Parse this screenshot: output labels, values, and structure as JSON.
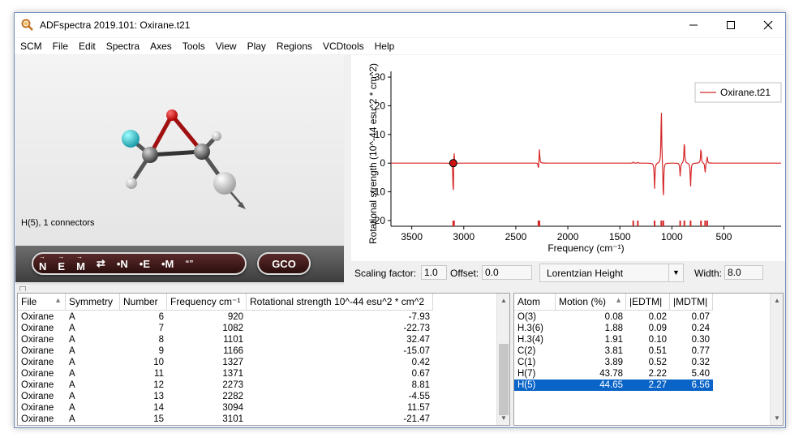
{
  "window": {
    "title": "ADFspectra 2019.101: Oxirane.t21",
    "controls": {
      "minimize_icon": "minimize-icon",
      "maximize_icon": "maximize-icon",
      "close_icon": "close-icon"
    }
  },
  "menu": [
    "SCM",
    "File",
    "Edit",
    "Spectra",
    "Axes",
    "Tools",
    "View",
    "Play",
    "Regions",
    "VCDtools",
    "Help"
  ],
  "molecule": {
    "status": "H(5), 1 connectors"
  },
  "view_toolbar": {
    "buttons": [
      "N",
      "E",
      "M",
      "⇄",
      "•N",
      "•E",
      "•M",
      "“”"
    ],
    "gco_label": "GCO"
  },
  "spectrum": {
    "legend": "Oxirane.t21",
    "ylabel": "Rotational strength (10^-44 esu^2 * cm^2)",
    "xlabel": "Frequency (cm⁻¹)",
    "y_ticks": [
      "30",
      "20",
      "10",
      "0",
      "-10",
      "-20"
    ],
    "x_ticks": [
      "3500",
      "3000",
      "2500",
      "2000",
      "1500",
      "1000",
      "500"
    ],
    "line_color": "#d62728"
  },
  "chart_data": {
    "type": "line",
    "title": "",
    "xlabel": "Frequency (cm⁻¹)",
    "ylabel": "Rotational strength (10^-44 esu^2 * cm^2)",
    "xlim": [
      3700,
      -50
    ],
    "ylim": [
      -22,
      32
    ],
    "grid": false,
    "legend_position": "top-right",
    "series": [
      {
        "name": "Oxirane.t21",
        "sticks": [
          [
            3101,
            -21.47
          ],
          [
            3094,
            11.57
          ],
          [
            2282,
            -4.55
          ],
          [
            2273,
            8.81
          ],
          [
            1371,
            0.67
          ],
          [
            1327,
            0.42
          ],
          [
            1166,
            -15.07
          ],
          [
            1101,
            32.47
          ],
          [
            1082,
            -22.73
          ],
          [
            920,
            -7.93
          ],
          [
            880,
            13.0
          ],
          [
            820,
            -14.0
          ],
          [
            720,
            9.0
          ],
          [
            680,
            -6.0
          ],
          [
            660,
            4.0
          ]
        ]
      }
    ],
    "selected_point": [
      3101,
      0
    ]
  },
  "scaling": {
    "scaling_label": "Scaling factor:",
    "scaling_value": "1.0",
    "offset_label": "Offset:",
    "offset_value": "0.0",
    "lineshape": "Lorentzian Height",
    "width_label": "Width:",
    "width_value": "8.0"
  },
  "modes_table": {
    "columns": [
      "File",
      "Symmetry",
      "Number",
      "Frequency cm⁻¹",
      "Rotational strength 10^-44 esu^2 * cm^2"
    ],
    "rows": [
      [
        "Oxirane",
        "A",
        "6",
        "920",
        "-7.93"
      ],
      [
        "Oxirane",
        "A",
        "7",
        "1082",
        "-22.73"
      ],
      [
        "Oxirane",
        "A",
        "8",
        "1101",
        "32.47"
      ],
      [
        "Oxirane",
        "A",
        "9",
        "1166",
        "-15.07"
      ],
      [
        "Oxirane",
        "A",
        "10",
        "1327",
        "0.42"
      ],
      [
        "Oxirane",
        "A",
        "11",
        "1371",
        "0.67"
      ],
      [
        "Oxirane",
        "A",
        "12",
        "2273",
        "8.81"
      ],
      [
        "Oxirane",
        "A",
        "13",
        "2282",
        "-4.55"
      ],
      [
        "Oxirane",
        "A",
        "14",
        "3094",
        "11.57"
      ],
      [
        "Oxirane",
        "A",
        "15",
        "3101",
        "-21.47"
      ]
    ]
  },
  "atoms_table": {
    "columns": [
      "Atom",
      "Motion (%)",
      "|EDTM|",
      "|MDTM|"
    ],
    "rows": [
      [
        "O(3)",
        "0.08",
        "0.02",
        "0.07"
      ],
      [
        "H.3(6)",
        "1.88",
        "0.09",
        "0.24"
      ],
      [
        "H.3(4)",
        "1.91",
        "0.10",
        "0.30"
      ],
      [
        "C(2)",
        "3.81",
        "0.51",
        "0.77"
      ],
      [
        "C(1)",
        "3.89",
        "0.52",
        "0.32"
      ],
      [
        "H(7)",
        "43.78",
        "2.22",
        "5.40"
      ],
      [
        "H(5)",
        "44.65",
        "2.27",
        "6.56"
      ]
    ],
    "selected_row": 6
  }
}
